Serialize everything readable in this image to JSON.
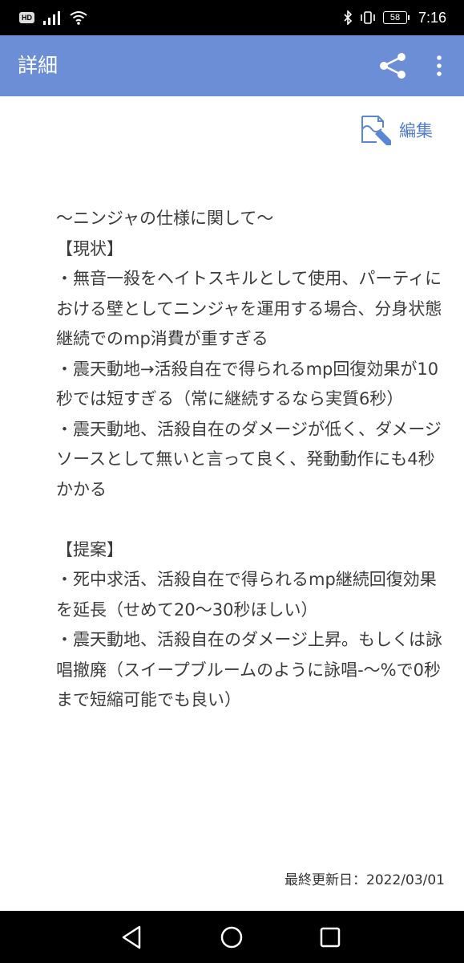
{
  "status_bar": {
    "hd_badge": "HD",
    "battery": "58",
    "time": "7:16",
    "icons": [
      "signal-icon",
      "wifi-icon",
      "bluetooth-icon",
      "vibrate-icon",
      "battery-icon"
    ]
  },
  "app_bar": {
    "title": "詳細",
    "color": "#6b8ed6",
    "share_icon": "share-icon",
    "more_icon": "more-vert-icon"
  },
  "edit": {
    "label": "編集",
    "icon": "edit-note-icon",
    "color": "#4f7bd0"
  },
  "content": {
    "body": "〜ニンジャの仕様に関して〜\n【現状】\n・無音一殺をヘイトスキルとして使用、パーティにおける壁としてニンジャを運用する場合、分身状態継続でのmp消費が重すぎる\n・震天動地→活殺自在で得られるmp回復効果が10秒では短すぎる（常に継続するなら実質6秒）\n・震天動地、活殺自在のダメージが低く、ダメージソースとして無いと言って良く、発動動作にも4秒かかる\n\n【提案】\n・死中求活、活殺自在で得られるmp継続回復効果を延長（せめて20〜30秒ほしい）\n・震天動地、活殺自在のダメージ上昇。もしくは詠唱撤廃（スイープブルームのように詠唱-〜%で0秒まで短縮可能でも良い）",
    "updated": "最終更新日：2022/03/01"
  },
  "nav_bar": {
    "back_icon": "back-triangle-icon",
    "home_icon": "home-circle-icon",
    "recents_icon": "recents-square-icon"
  }
}
